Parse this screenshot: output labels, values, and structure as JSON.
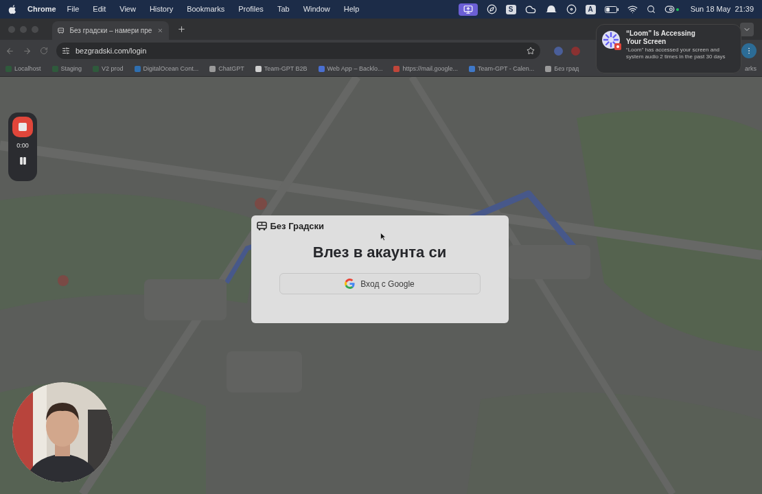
{
  "menu_bar": {
    "app": "Chrome",
    "menus": [
      "File",
      "Edit",
      "View",
      "History",
      "Bookmarks",
      "Profiles",
      "Tab",
      "Window",
      "Help"
    ],
    "status_items": [
      {
        "kind": "screen"
      },
      {
        "kind": "compass"
      },
      {
        "kind": "letter",
        "text": "S"
      },
      {
        "kind": "cloud"
      },
      {
        "kind": "hat"
      },
      {
        "kind": "disc"
      },
      {
        "kind": "letter",
        "text": "A"
      },
      {
        "kind": "battery"
      },
      {
        "kind": "wifi"
      },
      {
        "kind": "search"
      },
      {
        "kind": "control"
      }
    ],
    "clock": "Sun 18 May  21:39"
  },
  "tabs": [
    {
      "title": "Без градски – намери пре",
      "selected": true
    }
  ],
  "address_bar": {
    "url": "bezgradski.com/login"
  },
  "bookmarks": [
    {
      "label": "Localhost",
      "color": "#2f5a3c"
    },
    {
      "label": "Staging",
      "color": "#2f5a3c"
    },
    {
      "label": "V2 prod",
      "color": "#2f5a3c"
    },
    {
      "label": "DigitalOcean Cont...",
      "color": "#2f6fb0"
    },
    {
      "label": "ChatGPT",
      "color": "#9a9a9a"
    },
    {
      "label": "Team-GPT B2B",
      "color": "#cfcfcf"
    },
    {
      "label": "Web App – Backlo...",
      "color": "#4a6fd0"
    },
    {
      "label": "https://mail.google...",
      "color": "#c0463a"
    },
    {
      "label": "Team-GPT - Calen...",
      "color": "#3f78c8"
    },
    {
      "label": "Без град",
      "color": "#9a9a9a"
    }
  ],
  "bookmarks_end": "arks",
  "notification": {
    "title": "“Loom” Is Accessing Your Screen",
    "body": "“Loom” has accessed your screen and system audio 2 times in the past 30 days"
  },
  "recorder": {
    "time": "0:00"
  },
  "login": {
    "brand": "Без Градски",
    "heading": "Влез в акаунта си",
    "google_button": "Вход с Google"
  }
}
